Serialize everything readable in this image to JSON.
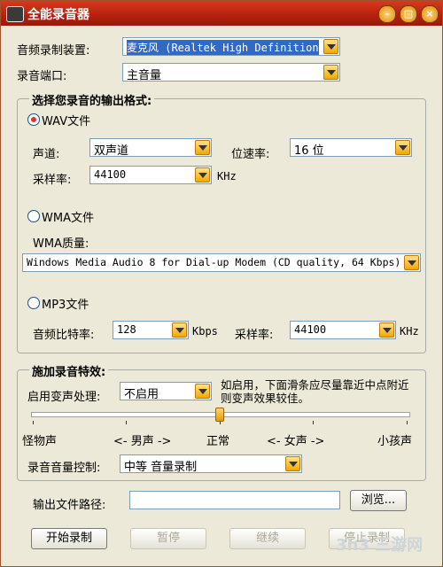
{
  "window": {
    "title": "全能录音器"
  },
  "device": {
    "label": "音频录制装置:",
    "value": "麦克风 (Realtek High Definition"
  },
  "port": {
    "label": "录音端口:",
    "value": "主音量"
  },
  "format_group": {
    "title": "选择您录音的输出格式:",
    "wav": {
      "label": "WAV文件",
      "selected": true,
      "channel_label": "声道:",
      "channel_value": "双声道",
      "bitrate_label": "位速率:",
      "bitrate_value": "16 位",
      "samplerate_label": "采样率:",
      "samplerate_value": "44100",
      "samplerate_unit": "KHz"
    },
    "wma": {
      "label": "WMA文件",
      "selected": false,
      "quality_label": "WMA质量:",
      "quality_value": "Windows Media Audio 8 for Dial-up Modem (CD quality, 64 Kbps)"
    },
    "mp3": {
      "label": "MP3文件",
      "selected": false,
      "bitrate_label": "音频比特率:",
      "bitrate_value": "128",
      "bitrate_unit": "Kbps",
      "samplerate_label": "采样率:",
      "samplerate_value": "44100",
      "samplerate_unit": "KHz"
    }
  },
  "effects_group": {
    "title": "施加录音特效:",
    "voice_label": "启用变声处理:",
    "voice_value": "不启用",
    "hint": "如启用，下面滑条应尽量靠近中点附近则变声效果较佳。",
    "slider_labels": [
      "怪物声",
      "<- 男声 ->",
      "正常",
      "<- 女声 ->",
      "小孩声"
    ],
    "slider_level": 0.5,
    "volume_label": "录音音量控制:",
    "volume_value": "中等 音量录制"
  },
  "output": {
    "label": "输出文件路径:",
    "value": "",
    "browse": "浏览..."
  },
  "actions": {
    "start": "开始录制",
    "pause": "暂停",
    "resume": "继续",
    "stop": "停止录制"
  },
  "watermark": "3h3 三游网"
}
